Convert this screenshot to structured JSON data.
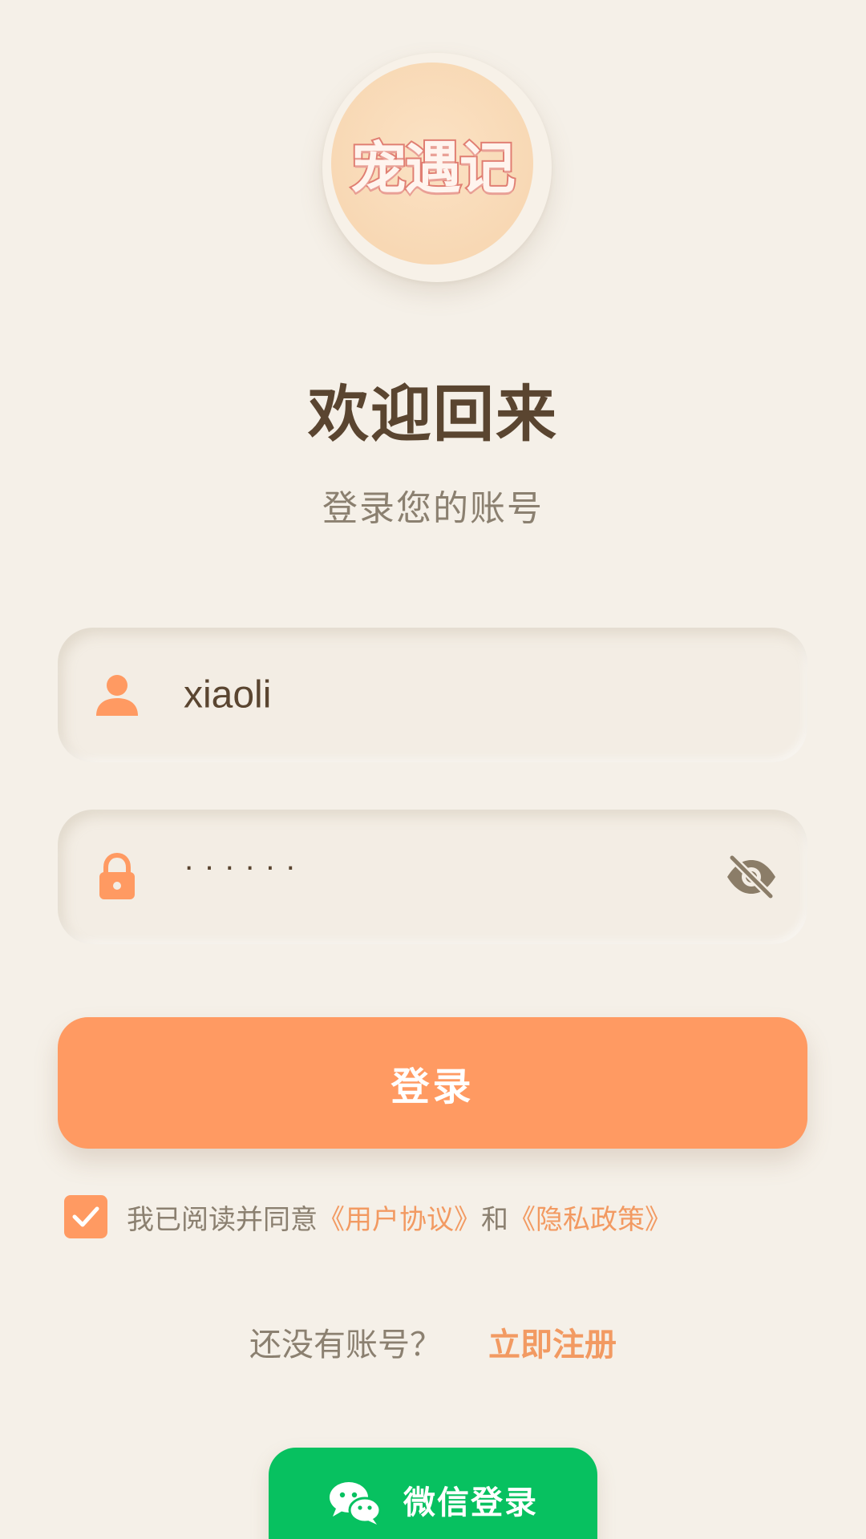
{
  "app": {
    "logo_text": "宠遇记"
  },
  "header": {
    "title": "欢迎回来",
    "subtitle": "登录您的账号"
  },
  "form": {
    "username": {
      "value": "xiaoli",
      "icon": "user-icon"
    },
    "password": {
      "value": "······",
      "icon": "lock-icon",
      "toggle_icon": "eye-off-icon"
    },
    "login_label": "登录"
  },
  "agreement": {
    "checked": true,
    "prefix": "我已阅读并同意",
    "user_agreement": "《用户协议》",
    "and": "和",
    "privacy_policy": "《隐私政策》"
  },
  "register": {
    "prompt": "还没有账号？",
    "link": "立即注册"
  },
  "wechat": {
    "label": "微信登录",
    "icon": "wechat-icon"
  },
  "colors": {
    "background": "#f5f0e8",
    "accent": "#ff9a62",
    "title": "#5a4530",
    "muted": "#8b8070",
    "wechat": "#07c160"
  }
}
